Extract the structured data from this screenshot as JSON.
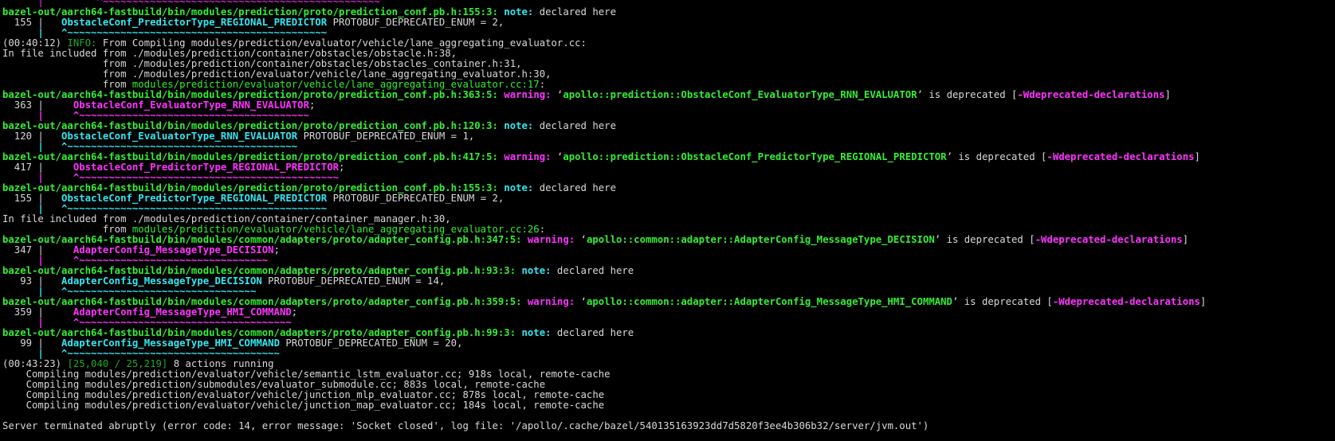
{
  "colors": {
    "background": "#000000",
    "default_text": "#d8d8d8",
    "path_green": "#33ee33",
    "note_cyan": "#33e6f0",
    "warning_magenta": "#ff33ff",
    "info_green": "#22aa22"
  },
  "terminal": {
    "lines": [
      {
        "segs": [
          {
            "t": "      |         ^~~~~~~~~~~~~~~~~~~~~~~~~~~~~~~~~~~~~~~~~~~~~~~~",
            "c": "m"
          }
        ]
      },
      {
        "segs": [
          {
            "t": "bazel-out/aarch64-fastbuild/bin/modules/prediction/proto/prediction_conf.pb.h:155:3: ",
            "c": "g",
            "b": true
          },
          {
            "t": "note:",
            "c": "c",
            "b": true
          },
          {
            "t": " declared here",
            "c": "w"
          }
        ]
      },
      {
        "segs": [
          {
            "t": "  155 |   ",
            "c": "w"
          },
          {
            "t": "ObstacleConf_PredictorType_REGIONAL_PREDICTOR",
            "c": "c",
            "b": true
          },
          {
            "t": " PROTOBUF_DEPRECATED_ENUM = 2,",
            "c": "w"
          }
        ]
      },
      {
        "segs": [
          {
            "t": "      |   ^~~~~~~~~~~~~~~~~~~~~~~~~~~~~~~~~~~~~~~~~~~~~",
            "c": "c",
            "b": true
          }
        ]
      },
      {
        "segs": [
          {
            "t": "(00:40:12) ",
            "c": "w"
          },
          {
            "t": "INFO:",
            "c": "dim"
          },
          {
            "t": " From Compiling modules/prediction/evaluator/vehicle/lane_aggregating_evaluator.cc:",
            "c": "w"
          }
        ]
      },
      {
        "segs": [
          {
            "t": "In file included from ./modules/prediction/container/obstacles/obstacle.h:38,",
            "c": "w"
          }
        ]
      },
      {
        "segs": [
          {
            "t": "                 from ./modules/prediction/container/obstacles/obstacles_container.h:31,",
            "c": "w"
          }
        ]
      },
      {
        "segs": [
          {
            "t": "                 from ./modules/prediction/evaluator/vehicle/lane_aggregating_evaluator.h:30,",
            "c": "w"
          }
        ]
      },
      {
        "segs": [
          {
            "t": "                 from ",
            "c": "w"
          },
          {
            "t": "modules/prediction/evaluator/vehicle/lane_aggregating_evaluator.cc:17",
            "c": "g"
          },
          {
            "t": ":",
            "c": "w"
          }
        ]
      },
      {
        "segs": [
          {
            "t": "bazel-out/aarch64-fastbuild/bin/modules/prediction/proto/prediction_conf.pb.h:363:5: ",
            "c": "g",
            "b": true
          },
          {
            "t": "warning:",
            "c": "m",
            "b": true
          },
          {
            "t": " ‘",
            "c": "w"
          },
          {
            "t": "apollo::prediction::ObstacleConf_EvaluatorType_RNN_EVALUATOR",
            "c": "g",
            "b": true
          },
          {
            "t": "’ is deprecated [",
            "c": "w"
          },
          {
            "t": "-Wdeprecated-declarations",
            "c": "m",
            "b": true
          },
          {
            "t": "]",
            "c": "w"
          }
        ]
      },
      {
        "segs": [
          {
            "t": "  363 |     ",
            "c": "w"
          },
          {
            "t": "ObstacleConf_EvaluatorType_RNN_EVALUATOR",
            "c": "m",
            "b": true
          },
          {
            "t": ";",
            "c": "w"
          }
        ]
      },
      {
        "segs": [
          {
            "t": "      |     ^~~~~~~~~~~~~~~~~~~~~~~~~~~~~~~~~~~~~~~~",
            "c": "m",
            "b": true
          }
        ]
      },
      {
        "segs": [
          {
            "t": "bazel-out/aarch64-fastbuild/bin/modules/prediction/proto/prediction_conf.pb.h:120:3: ",
            "c": "g",
            "b": true
          },
          {
            "t": "note:",
            "c": "c",
            "b": true
          },
          {
            "t": " declared here",
            "c": "w"
          }
        ]
      },
      {
        "segs": [
          {
            "t": "  120 |   ",
            "c": "w"
          },
          {
            "t": "ObstacleConf_EvaluatorType_RNN_EVALUATOR",
            "c": "c",
            "b": true
          },
          {
            "t": " PROTOBUF_DEPRECATED_ENUM = 1,",
            "c": "w"
          }
        ]
      },
      {
        "segs": [
          {
            "t": "      |   ^~~~~~~~~~~~~~~~~~~~~~~~~~~~~~~~~~~~~~~~",
            "c": "c",
            "b": true
          }
        ]
      },
      {
        "segs": [
          {
            "t": "bazel-out/aarch64-fastbuild/bin/modules/prediction/proto/prediction_conf.pb.h:417:5: ",
            "c": "g",
            "b": true
          },
          {
            "t": "warning:",
            "c": "m",
            "b": true
          },
          {
            "t": " ‘",
            "c": "w"
          },
          {
            "t": "apollo::prediction::ObstacleConf_PredictorType_REGIONAL_PREDICTOR",
            "c": "g",
            "b": true
          },
          {
            "t": "’ is deprecated [",
            "c": "w"
          },
          {
            "t": "-Wdeprecated-declarations",
            "c": "m",
            "b": true
          },
          {
            "t": "]",
            "c": "w"
          }
        ]
      },
      {
        "segs": [
          {
            "t": "  417 |     ",
            "c": "w"
          },
          {
            "t": "ObstacleConf_PredictorType_REGIONAL_PREDICTOR",
            "c": "m",
            "b": true
          },
          {
            "t": ";",
            "c": "w"
          }
        ]
      },
      {
        "segs": [
          {
            "t": "      |     ^~~~~~~~~~~~~~~~~~~~~~~~~~~~~~~~~~~~~~~~~~~~~",
            "c": "m",
            "b": true
          }
        ]
      },
      {
        "segs": [
          {
            "t": "bazel-out/aarch64-fastbuild/bin/modules/prediction/proto/prediction_conf.pb.h:155:3: ",
            "c": "g",
            "b": true
          },
          {
            "t": "note:",
            "c": "c",
            "b": true
          },
          {
            "t": " declared here",
            "c": "w"
          }
        ]
      },
      {
        "segs": [
          {
            "t": "  155 |   ",
            "c": "w"
          },
          {
            "t": "ObstacleConf_PredictorType_REGIONAL_PREDICTOR",
            "c": "c",
            "b": true
          },
          {
            "t": " PROTOBUF_DEPRECATED_ENUM = 2,",
            "c": "w"
          }
        ]
      },
      {
        "segs": [
          {
            "t": "      |   ^~~~~~~~~~~~~~~~~~~~~~~~~~~~~~~~~~~~~~~~~~~~~",
            "c": "c",
            "b": true
          }
        ]
      },
      {
        "segs": [
          {
            "t": "In file included from ./modules/prediction/container/container_manager.h:30,",
            "c": "w"
          }
        ]
      },
      {
        "segs": [
          {
            "t": "                 from ",
            "c": "w"
          },
          {
            "t": "modules/prediction/evaluator/vehicle/lane_aggregating_evaluator.cc:26",
            "c": "g"
          },
          {
            "t": ":",
            "c": "w"
          }
        ]
      },
      {
        "segs": [
          {
            "t": "bazel-out/aarch64-fastbuild/bin/modules/common/adapters/proto/adapter_config.pb.h:347:5: ",
            "c": "g",
            "b": true
          },
          {
            "t": "warning:",
            "c": "m",
            "b": true
          },
          {
            "t": " ‘",
            "c": "w"
          },
          {
            "t": "apollo::common::adapter::AdapterConfig_MessageType_DECISION",
            "c": "g",
            "b": true
          },
          {
            "t": "’ is deprecated [",
            "c": "w"
          },
          {
            "t": "-Wdeprecated-declarations",
            "c": "m",
            "b": true
          },
          {
            "t": "]",
            "c": "w"
          }
        ]
      },
      {
        "segs": [
          {
            "t": "  347 |     ",
            "c": "w"
          },
          {
            "t": "AdapterConfig_MessageType_DECISION",
            "c": "m",
            "b": true
          },
          {
            "t": ";",
            "c": "w"
          }
        ]
      },
      {
        "segs": [
          {
            "t": "      |     ^~~~~~~~~~~~~~~~~~~~~~~~~~~~~~~~~",
            "c": "m",
            "b": true
          }
        ]
      },
      {
        "segs": [
          {
            "t": "bazel-out/aarch64-fastbuild/bin/modules/common/adapters/proto/adapter_config.pb.h:93:3: ",
            "c": "g",
            "b": true
          },
          {
            "t": "note:",
            "c": "c",
            "b": true
          },
          {
            "t": " declared here",
            "c": "w"
          }
        ]
      },
      {
        "segs": [
          {
            "t": "   93 |   ",
            "c": "w"
          },
          {
            "t": "AdapterConfig_MessageType_DECISION",
            "c": "c",
            "b": true
          },
          {
            "t": " PROTOBUF_DEPRECATED_ENUM = 14,",
            "c": "w"
          }
        ]
      },
      {
        "segs": [
          {
            "t": "      |   ^~~~~~~~~~~~~~~~~~~~~~~~~~~~~~~~~",
            "c": "c",
            "b": true
          }
        ]
      },
      {
        "segs": [
          {
            "t": "bazel-out/aarch64-fastbuild/bin/modules/common/adapters/proto/adapter_config.pb.h:359:5: ",
            "c": "g",
            "b": true
          },
          {
            "t": "warning:",
            "c": "m",
            "b": true
          },
          {
            "t": " ‘",
            "c": "w"
          },
          {
            "t": "apollo::common::adapter::AdapterConfig_MessageType_HMI_COMMAND",
            "c": "g",
            "b": true
          },
          {
            "t": "’ is deprecated [",
            "c": "w"
          },
          {
            "t": "-Wdeprecated-declarations",
            "c": "m",
            "b": true
          },
          {
            "t": "]",
            "c": "w"
          }
        ]
      },
      {
        "segs": [
          {
            "t": "  359 |     ",
            "c": "w"
          },
          {
            "t": "AdapterConfig_MessageType_HMI_COMMAND",
            "c": "m",
            "b": true
          },
          {
            "t": ";",
            "c": "w"
          }
        ]
      },
      {
        "segs": [
          {
            "t": "      |     ^~~~~~~~~~~~~~~~~~~~~~~~~~~~~~~~~~~~~",
            "c": "m",
            "b": true
          }
        ]
      },
      {
        "segs": [
          {
            "t": "bazel-out/aarch64-fastbuild/bin/modules/common/adapters/proto/adapter_config.pb.h:99:3: ",
            "c": "g",
            "b": true
          },
          {
            "t": "note:",
            "c": "c",
            "b": true
          },
          {
            "t": " declared here",
            "c": "w"
          }
        ]
      },
      {
        "segs": [
          {
            "t": "   99 |   ",
            "c": "w"
          },
          {
            "t": "AdapterConfig_MessageType_HMI_COMMAND",
            "c": "c",
            "b": true
          },
          {
            "t": " PROTOBUF_DEPRECATED_ENUM = 20,",
            "c": "w"
          }
        ]
      },
      {
        "segs": [
          {
            "t": "      |   ^~~~~~~~~~~~~~~~~~~~~~~~~~~~~~~~~~~~~",
            "c": "c",
            "b": true
          }
        ]
      },
      {
        "segs": [
          {
            "t": "(00:43:23) ",
            "c": "w"
          },
          {
            "t": "[25,040 / 25,219]",
            "c": "dim"
          },
          {
            "t": " 8 actions running",
            "c": "w"
          }
        ]
      },
      {
        "segs": [
          {
            "t": "    Compiling modules/prediction/evaluator/vehicle/semantic_lstm_evaluator.cc; 918s local, remote-cache",
            "c": "w"
          }
        ]
      },
      {
        "segs": [
          {
            "t": "    Compiling modules/prediction/submodules/evaluator_submodule.cc; 883s local, remote-cache",
            "c": "w"
          }
        ]
      },
      {
        "segs": [
          {
            "t": "    Compiling modules/prediction/evaluator/vehicle/junction_mlp_evaluator.cc; 878s local, remote-cache",
            "c": "w"
          }
        ]
      },
      {
        "segs": [
          {
            "t": "    Compiling modules/prediction/evaluator/vehicle/junction_map_evaluator.cc; 184s local, remote-cache",
            "c": "w"
          }
        ]
      },
      {
        "segs": [
          {
            "t": "",
            "c": "w"
          }
        ]
      },
      {
        "segs": [
          {
            "t": "Server terminated abruptly (error code: 14, error message: 'Socket closed', log file: '/apollo/.cache/bazel/540135163923dd7d5820f3ee4b306b32/server/jvm.out')",
            "c": "w"
          }
        ]
      }
    ]
  }
}
